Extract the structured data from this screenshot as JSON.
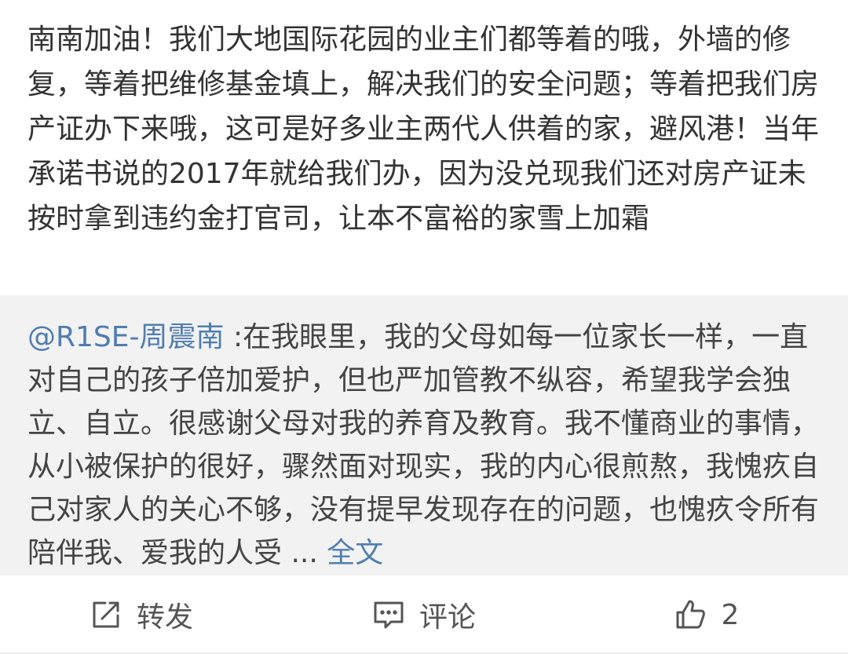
{
  "post": {
    "text": "南南加油！我们大地国际花园的业主们都等着的哦，外墙的修复，等着把维修基金填上，解决我们的安全问题；等着把我们房产证办下来哦，这可是好多业主两代人供着的家，避风港！当年承诺书说的2017年就给我们办，因为没兑现我们还对房产证未按时拿到违约金打官司，让本不富裕的家雪上加霜"
  },
  "quoted": {
    "mention": "@R1SE-周震南",
    "text": " :在我眼里，我的父母如每一位家长一样，一直对自己的孩子倍加爱护，但也严加管教不纵容，希望我学会独立、自立。很感谢父母对我的养育及教育。我不懂商业的事情，从小被保护的很好，骤然面对现实，我的内心很煎熬，我愧疚自己对家人的关心不够，没有提早发现存在的问题，也愧疚令所有陪伴我、爱我的人受 ... ",
    "more_label": "全文"
  },
  "actions": {
    "repost_label": "转发",
    "comment_label": "评论",
    "like_count": "2"
  },
  "colors": {
    "link": "#507daf",
    "quoted_bg": "#f2f2f2",
    "text": "#333333"
  },
  "icons": {
    "repost": "share-edit-icon",
    "comment": "comment-icon",
    "like": "thumbs-up-icon"
  }
}
